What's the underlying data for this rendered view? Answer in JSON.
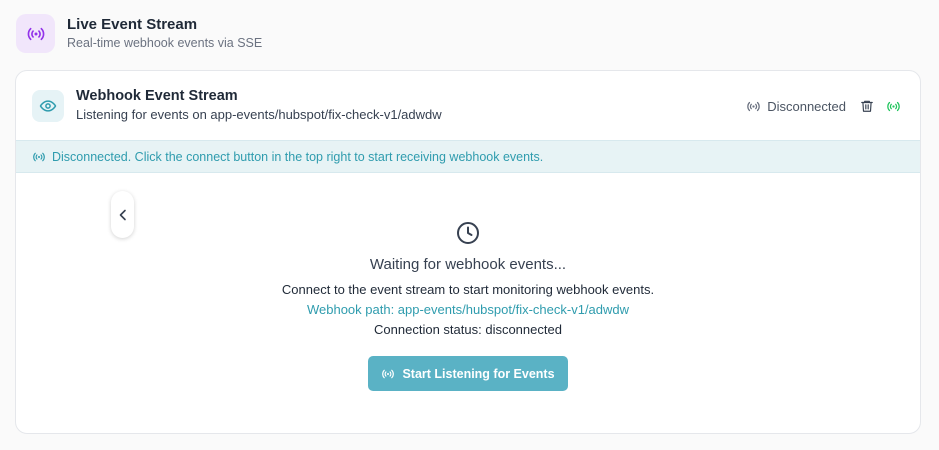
{
  "page_header": {
    "title": "Live Event Stream",
    "subtitle": "Real-time webhook events via SSE",
    "icon": "broadcast-icon",
    "icon_color": "#9333ea"
  },
  "stream_card": {
    "title": "Webhook Event Stream",
    "subtitle": "Listening for events on app-events/hubspot/fix-check-v1/adwdw",
    "status_label": "Disconnected",
    "connect_icon_color": "#22c55e"
  },
  "banner": {
    "message": "Disconnected. Click the connect button in the top right to start receiving webhook events.",
    "color": "#2f9cae"
  },
  "empty_state": {
    "title": "Waiting for webhook events...",
    "description": "Connect to the event stream to start monitoring webhook events.",
    "webhook_path": "Webhook path: app-events/hubspot/fix-check-v1/adwdw",
    "connection_status": "Connection status: disconnected",
    "button_label": "Start Listening for Events",
    "button_color": "#5ab2c5"
  }
}
